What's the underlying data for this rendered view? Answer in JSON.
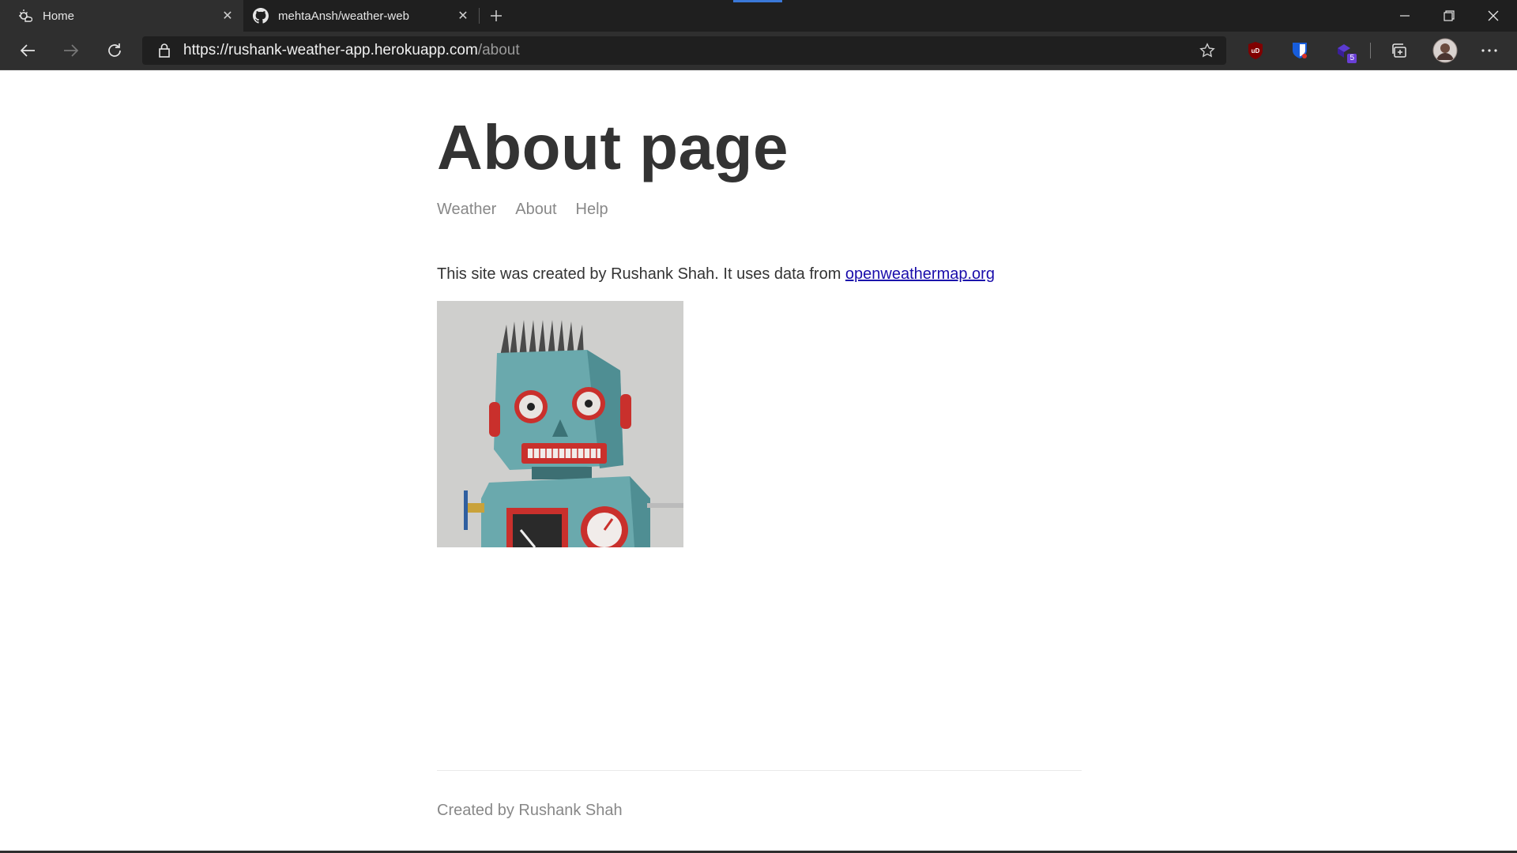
{
  "browser": {
    "tabs": [
      {
        "title": "Home",
        "favicon": "weather-app-icon",
        "active": true
      },
      {
        "title": "mehtaAnsh/weather-web",
        "favicon": "github-icon",
        "active": false
      }
    ],
    "address": {
      "host": "https://rushank-weather-app.herokuapp.com",
      "path": "/about"
    },
    "extensions": [
      {
        "name": "ublock-origin-icon",
        "label": "uD",
        "color": "#800000"
      },
      {
        "name": "bitwarden-icon",
        "color": "#175ddc"
      },
      {
        "name": "extension-icon",
        "badge": "5",
        "color": "#5b3bd1"
      }
    ]
  },
  "page": {
    "title": "About page",
    "nav": [
      "Weather",
      "About",
      "Help"
    ],
    "about_text": "This site was created by Rushank Shah. It uses data from ",
    "about_link": "openweathermap.org",
    "image": "robot-image",
    "footer": "Created by Rushank Shah"
  },
  "colors": {
    "chrome_dark": "#1f1f1f",
    "chrome_mid": "#2f2f2f",
    "link": "#1a0dab",
    "text": "#333333",
    "muted": "#888888"
  }
}
